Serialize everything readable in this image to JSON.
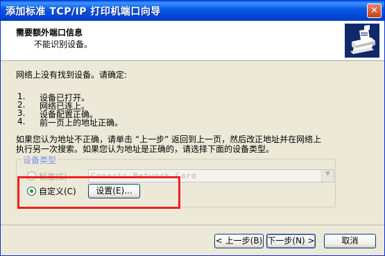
{
  "window": {
    "title": "添加标准 TCP/IP 打印机端口向导",
    "close_glyph": "✕"
  },
  "header": {
    "title": "需要额外端口信息",
    "subtitle": "不能识别设备。",
    "icon": "printer-wizard-icon"
  },
  "body": {
    "intro": "网络上没有找到设备。请确定:",
    "checklist": [
      {
        "num": "1.",
        "text": "设备已打开。"
      },
      {
        "num": "2.",
        "text": "网络已连上。"
      },
      {
        "num": "3.",
        "text": "设备配置正确。"
      },
      {
        "num": "4.",
        "text": "前一页上的地址正确。"
      }
    ],
    "note_line1": "如果您认为地址不正确，请单击 “上一步” 返回到上一页，然后改正地址并在网络上",
    "note_line2": "执行另一次搜索。如果您认为地址是正确的，请选择下面的设备类型。"
  },
  "device_type": {
    "legend": "设备类型",
    "standard_label": "标准(S)",
    "standard_value": "Generic Network Card",
    "custom_label": "自定义(C)",
    "settings_button": "设置(E)..."
  },
  "footer": {
    "back_button": "< 上一步(B)",
    "next_button": "下一步(N) >",
    "cancel_button": "取消"
  },
  "colors": {
    "title_bar": "#0a5ae6",
    "dialog_bg": "#ece9d8",
    "highlight": "#ef1f1f",
    "legend": "#7a96df"
  }
}
